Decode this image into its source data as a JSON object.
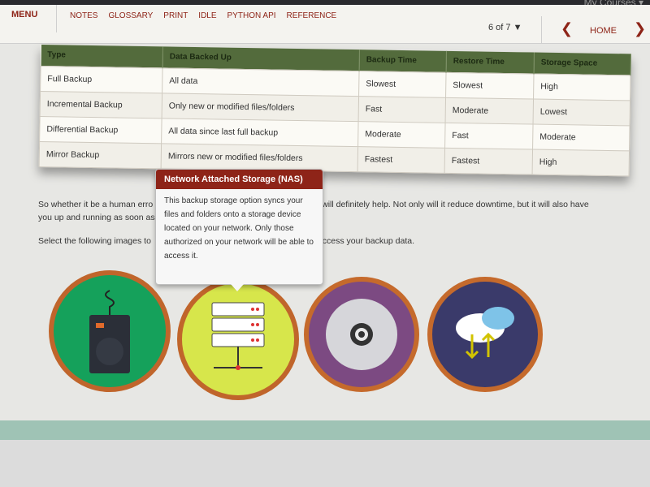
{
  "header": {
    "my_courses": "My Courses ▾",
    "menu": "MENU",
    "links": [
      "NOTES",
      "GLOSSARY",
      "PRINT",
      "IDLE",
      "PYTHON API",
      "REFERENCE"
    ],
    "pager": "6 of 7 ▼",
    "home": "HOME"
  },
  "table": {
    "headers": [
      "Type",
      "Data Backed Up",
      "Backup Time",
      "Restore Time",
      "Storage Space"
    ],
    "rows": [
      [
        "Full Backup",
        "All data",
        "Slowest",
        "Slowest",
        "High"
      ],
      [
        "Incremental Backup",
        "Only new or modified files/folders",
        "Fast",
        "Moderate",
        "Lowest"
      ],
      [
        "Differential Backup",
        "All data since last full backup",
        "Moderate",
        "Fast",
        "Moderate"
      ],
      [
        "Mirror Backup",
        "Mirrors new or modified files/folders",
        "Fastest",
        "Fastest",
        "High"
      ]
    ]
  },
  "content": {
    "p1_start": "So whether it be a human erro",
    "p1_end": "backups will definitely help. Not only will it reduce downtime, but it will also have",
    "p1_line2": "you up and running as soon as",
    "p2_start": "Select the following images to",
    "p2_end": "e and access your backup data."
  },
  "tooltip": {
    "title": "Network Attached Storage (NAS)",
    "body": "This backup storage option syncs your files and folders onto a storage device located on your network. Only those authorized on your network will be able to access it."
  },
  "icons": [
    "external-drive-icon",
    "nas-server-icon",
    "optical-disc-icon",
    "cloud-sync-icon"
  ]
}
